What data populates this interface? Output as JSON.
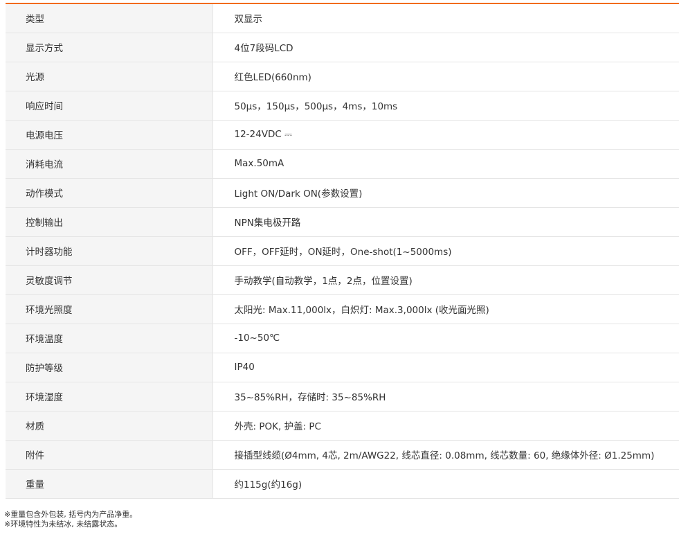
{
  "theme": {
    "accent": "#f26b1d",
    "label_bg": "#f5f5f5",
    "border": "#e5e5e5"
  },
  "specs": [
    {
      "label": "类型",
      "value": "双显示"
    },
    {
      "label": "显示方式",
      "value": "4位7段码LCD"
    },
    {
      "label": "光源",
      "value": "红色LED(660nm)"
    },
    {
      "label": "响应时间",
      "value": "50μs，150μs，500μs，4ms，10ms"
    },
    {
      "label": "电源电压",
      "value": "12-24VDC ⎓"
    },
    {
      "label": "消耗电流",
      "value": "Max.50mA"
    },
    {
      "label": "动作模式",
      "value": "Light ON/Dark ON(参数设置)"
    },
    {
      "label": "控制输出",
      "value": "NPN集电极开路"
    },
    {
      "label": "计时器功能",
      "value": "OFF，OFF延时，ON延时，One-shot(1~5000ms)"
    },
    {
      "label": "灵敏度调节",
      "value": "手动教学(自动教学，1点，2点，位置设置)"
    },
    {
      "label": "环境光照度",
      "value": "太阳光: Max.11,000lx，白炽灯: Max.3,000lx (收光面光照)"
    },
    {
      "label": "环境温度",
      "value": "-10~50℃"
    },
    {
      "label": "防护等级",
      "value": "IP40"
    },
    {
      "label": "环境湿度",
      "value": "35~85%RH，存储时: 35~85%RH"
    },
    {
      "label": "材质",
      "value": "外壳: POK, 护盖: PC"
    },
    {
      "label": "附件",
      "value": "接插型线缆(Ø4mm, 4芯, 2m/AWG22, 线芯直径: 0.08mm, 线芯数量: 60, 绝缘体外径: Ø1.25mm)"
    },
    {
      "label": "重量",
      "value": "约115g(约16g)"
    }
  ],
  "notes": [
    "※重量包含外包装, 括号内为产品净重。",
    "※环境特性为未结冰, 未结露状态。"
  ]
}
